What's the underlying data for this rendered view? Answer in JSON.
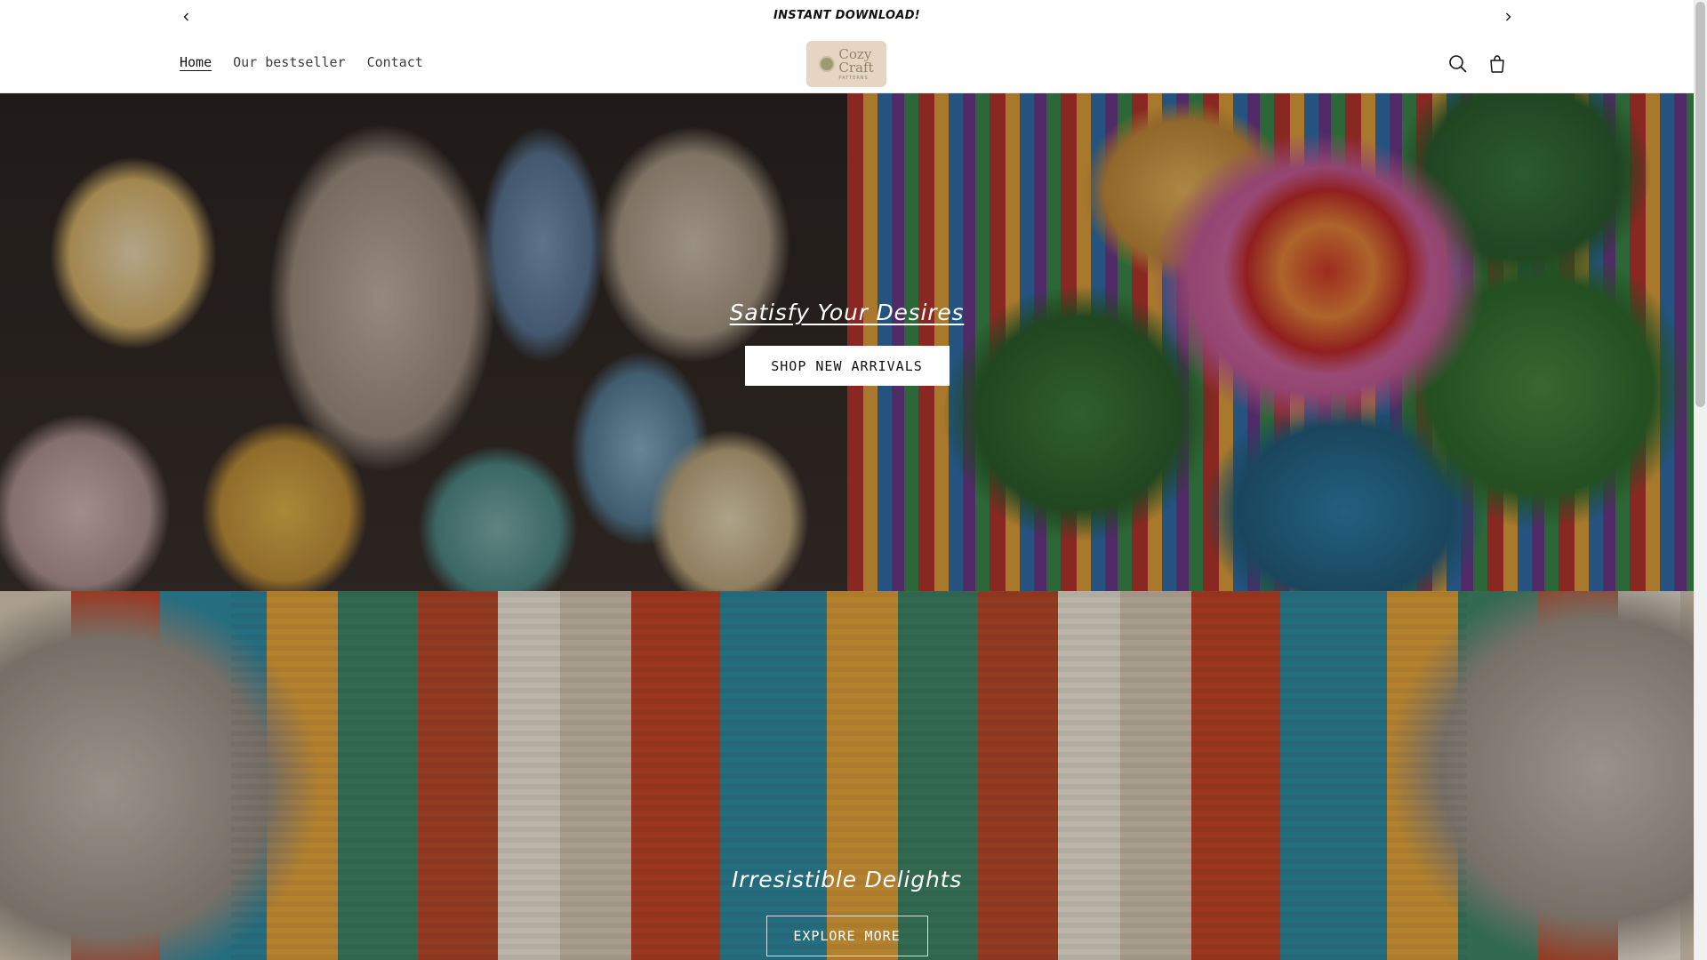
{
  "announcement": {
    "message": "INSTANT DOWNLOAD!",
    "prev_icon": "chevron-left-icon",
    "next_icon": "chevron-right-icon"
  },
  "header": {
    "nav": [
      {
        "label": "Home",
        "active": true
      },
      {
        "label": "Our bestseller",
        "active": false
      },
      {
        "label": "Contact",
        "active": false
      }
    ],
    "logo": {
      "line1": "Cozy",
      "line2": "Craft",
      "line3": "PATTERNS"
    },
    "icons": {
      "search": "search-icon",
      "cart": "cart-icon"
    }
  },
  "hero_1": {
    "heading": "Satisfy Your Desires",
    "button_label": "SHOP NEW ARRIVALS"
  },
  "hero_2": {
    "heading": "Irresistible Delights",
    "button_label": "EXPLORE MORE"
  },
  "colors": {
    "text": "#121212",
    "background": "#ffffff",
    "logo_bg": "#e6d5c3",
    "logo_text": "#8c8767"
  }
}
